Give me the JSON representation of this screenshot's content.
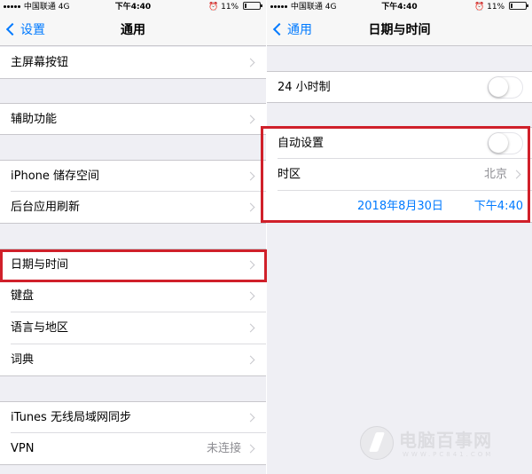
{
  "left": {
    "status": {
      "carrier": "中国联通",
      "network": "4G",
      "time": "下午4:40",
      "battery": "11%"
    },
    "nav": {
      "back_label": "设置",
      "title": "通用"
    },
    "rows": {
      "home_button": {
        "label": "主屏幕按钮"
      },
      "accessibility": {
        "label": "辅助功能"
      },
      "iphone_storage": {
        "label": "iPhone 储存空间"
      },
      "background_refresh": {
        "label": "后台应用刷新"
      },
      "date_time": {
        "label": "日期与时间"
      },
      "keyboard": {
        "label": "键盘"
      },
      "language_region": {
        "label": "语言与地区"
      },
      "dictionary": {
        "label": "词典"
      },
      "itunes_wifi_sync": {
        "label": "iTunes 无线局域网同步"
      },
      "vpn": {
        "label": "VPN",
        "detail": "未连接"
      }
    }
  },
  "right": {
    "status": {
      "carrier": "中国联通",
      "network": "4G",
      "time": "下午4:40",
      "battery": "11%"
    },
    "nav": {
      "back_label": "通用",
      "title": "日期与时间"
    },
    "rows": {
      "hour24": {
        "label": "24 小时制",
        "on": false
      },
      "auto_set": {
        "label": "自动设置",
        "on": false
      },
      "time_zone": {
        "label": "时区",
        "detail": "北京"
      },
      "datetime": {
        "date": "2018年8月30日",
        "time": "下午4:40"
      }
    }
  },
  "watermark": {
    "name": "电脑百事网",
    "url": "WWW.PC841.COM"
  },
  "colors": {
    "accent": "#007aff",
    "highlight": "#d0202a",
    "background": "#efeff4"
  }
}
